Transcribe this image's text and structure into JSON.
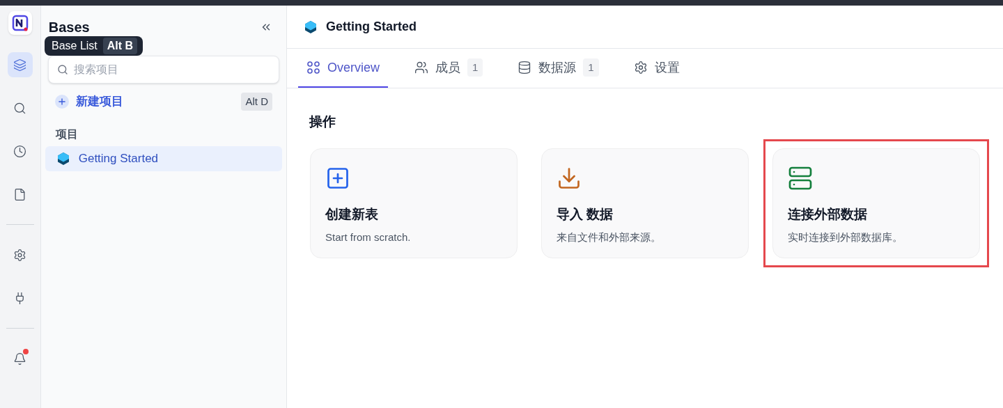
{
  "rail": {
    "items": [
      {
        "kind": "bases",
        "selected": true
      },
      {
        "kind": "search",
        "selected": false
      },
      {
        "kind": "history",
        "selected": false
      },
      {
        "kind": "docs",
        "selected": false
      },
      {
        "kind": "divider"
      },
      {
        "kind": "settings",
        "selected": false
      },
      {
        "kind": "integrations",
        "selected": false
      },
      {
        "kind": "divider"
      },
      {
        "kind": "notifications",
        "selected": false,
        "unread": true
      }
    ]
  },
  "tooltip": {
    "label": "Base List",
    "shortcut": "Alt B"
  },
  "sidebar": {
    "title": "Bases",
    "search": {
      "placeholder": "搜索项目"
    },
    "new_button": {
      "label": "新建项目",
      "shortcut": "Alt D"
    },
    "section": "项目",
    "items": [
      {
        "label": "Getting Started",
        "selected": true
      }
    ]
  },
  "header": {
    "title": "Getting Started"
  },
  "tabs": [
    {
      "kind": "overview",
      "label": "Overview",
      "selected": true
    },
    {
      "kind": "members",
      "label": "成员",
      "count": "1",
      "selected": false
    },
    {
      "kind": "sources",
      "label": "数据源",
      "count": "1",
      "selected": false
    },
    {
      "kind": "settings",
      "label": "设置",
      "selected": false
    }
  ],
  "section_title": "操作",
  "actions": [
    {
      "kind": "create",
      "title": "创建新表",
      "subtitle": "Start from scratch.",
      "highlighted": false
    },
    {
      "kind": "import",
      "title": "导入 数据",
      "subtitle": "来自文件和外部来源。",
      "highlighted": false
    },
    {
      "kind": "connect",
      "title": "连接外部数据",
      "subtitle": "实时连接到外部数据库。",
      "highlighted": true
    }
  ]
}
